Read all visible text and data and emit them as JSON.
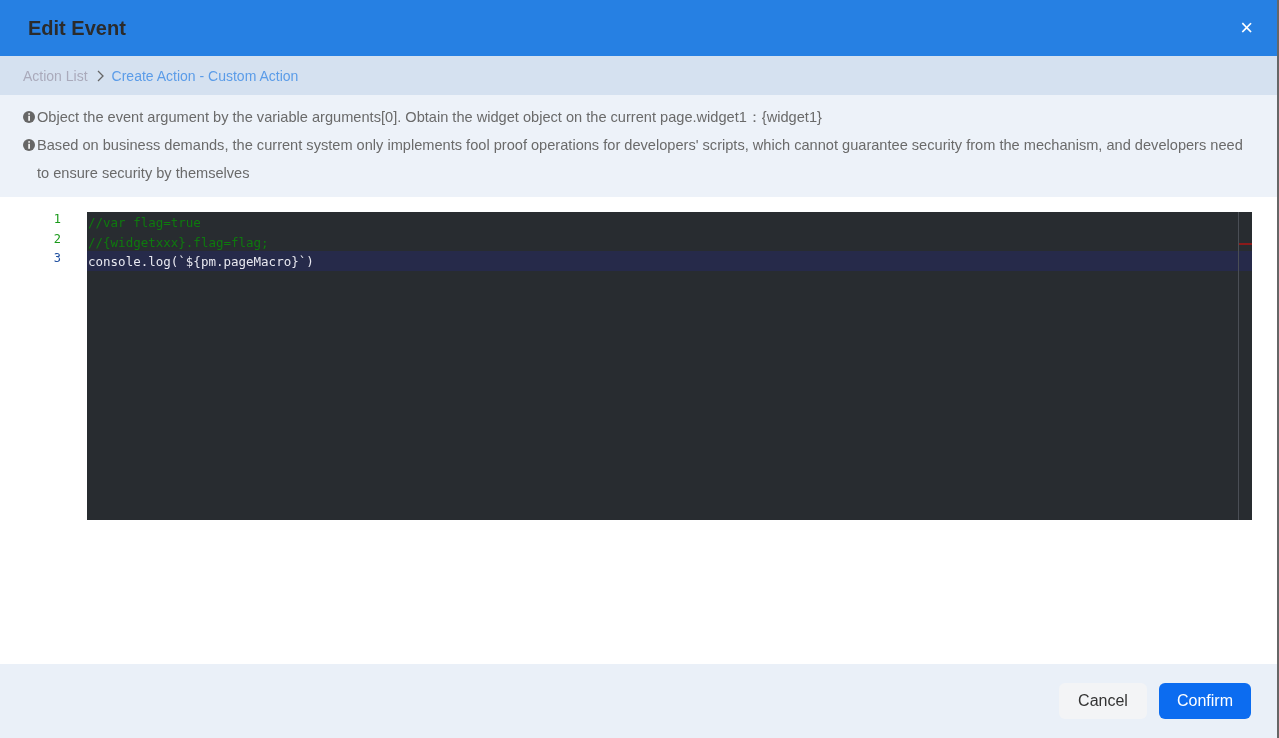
{
  "dialog": {
    "title": "Edit Event",
    "close": "×"
  },
  "breadcrumb": [
    {
      "label": "Action List",
      "selected": false
    },
    {
      "label": "Create Action - Custom Action",
      "selected": true
    }
  ],
  "notes": [
    "Object the event argument by the variable arguments[0]. Obtain the widget object on the current page.widget1：{widget1}",
    "Based on business demands, the current system only implements fool proof operations for developers' scripts, which cannot guarantee security from the mechanism, and developers need to ensure security by themselves"
  ],
  "editor": {
    "lines": [
      {
        "number": "1",
        "kind": "comment",
        "selected": false,
        "text": "//var flag=true"
      },
      {
        "number": "2",
        "kind": "comment",
        "selected": false,
        "text": "//{widgetxxx}.flag=flag;"
      },
      {
        "number": "3",
        "kind": "code",
        "selected": true,
        "text": "console.log(`${pm.pageMacro}`)"
      }
    ]
  },
  "buttons": [
    {
      "label": "Cancel",
      "kind": "secondary"
    },
    {
      "label": "Confirm",
      "kind": "primary"
    }
  ]
}
